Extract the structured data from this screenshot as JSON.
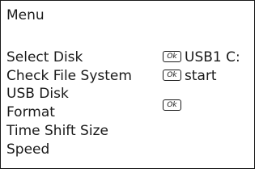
{
  "menu": {
    "title": "Menu",
    "ok_key_label": "Ok",
    "items": [
      {
        "label": "Select  Disk",
        "value": "USB1 C:",
        "has_ok": true
      },
      {
        "label": "Check File System",
        "value": "start",
        "has_ok": true
      },
      {
        "label": "USB Disk",
        "value": "",
        "has_ok": false
      },
      {
        "label": "Format",
        "value": "",
        "has_ok": true
      },
      {
        "label": "Time Shift Size",
        "value": "",
        "has_ok": false
      },
      {
        "label": "Speed",
        "value": "",
        "has_ok": false
      }
    ]
  }
}
